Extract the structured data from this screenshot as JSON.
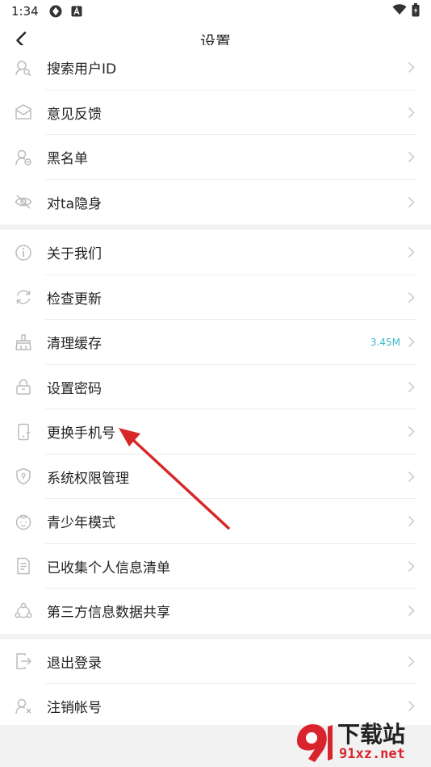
{
  "status_bar": {
    "time": "1:34"
  },
  "header": {
    "title": "设置"
  },
  "groups": [
    {
      "items": [
        {
          "label": "搜索用户ID",
          "icon": "search-user-icon"
        },
        {
          "label": "意见反馈",
          "icon": "feedback-mail-icon"
        },
        {
          "label": "黑名单",
          "icon": "blocklist-user-icon"
        },
        {
          "label": "对ta隐身",
          "icon": "eye-hidden-icon"
        }
      ]
    },
    {
      "items": [
        {
          "label": "关于我们",
          "icon": "info-icon"
        },
        {
          "label": "检查更新",
          "icon": "refresh-icon"
        },
        {
          "label": "清理缓存",
          "icon": "broom-icon",
          "value": "3.45M"
        },
        {
          "label": "设置密码",
          "icon": "lock-icon"
        },
        {
          "label": "更换手机号",
          "icon": "phone-icon"
        },
        {
          "label": "系统权限管理",
          "icon": "shield-icon"
        },
        {
          "label": "青少年模式",
          "icon": "child-face-icon"
        },
        {
          "label": "已收集个人信息清单",
          "icon": "document-list-icon"
        },
        {
          "label": "第三方信息数据共享",
          "icon": "share-icon"
        }
      ]
    },
    {
      "items": [
        {
          "label": "退出登录",
          "icon": "logout-icon"
        },
        {
          "label": "注销帐号",
          "icon": "user-remove-icon"
        }
      ]
    }
  ],
  "colors": {
    "accent_value": "#3fb6c8",
    "arrow": "#d62828",
    "watermark": "#d9232d"
  },
  "watermark": {
    "brand": "下载站",
    "domain": "91xz.net"
  }
}
